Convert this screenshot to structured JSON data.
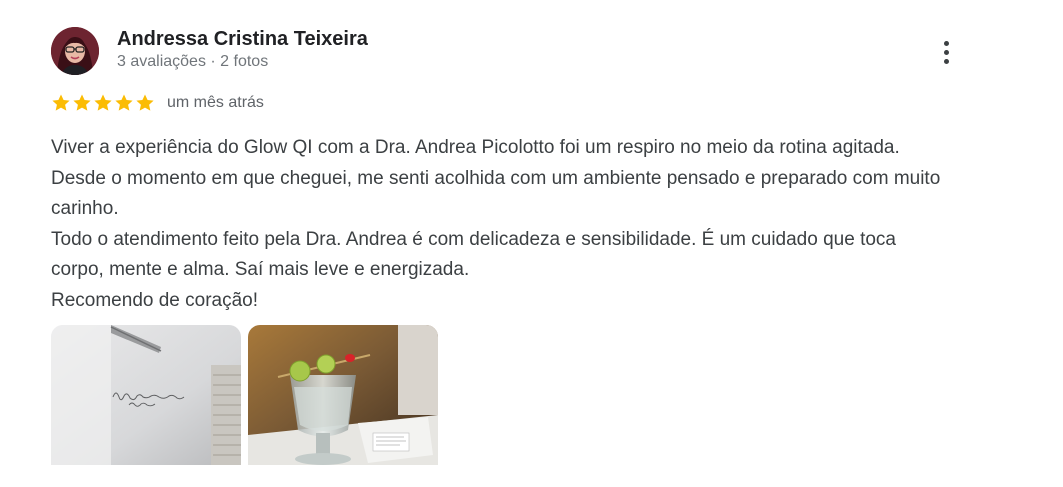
{
  "review": {
    "author": {
      "name": "Andressa Cristina Teixeira",
      "meta": "3 avaliações · 2 fotos",
      "avatar_icon": "user-avatar"
    },
    "rating": {
      "stars": 5,
      "max": 5,
      "star_color": "#fbbc04"
    },
    "date": "um mês atrás",
    "text_lines": [
      "Viver a experiência do Glow QI com a Dra. Andrea Picolotto foi um respiro no meio da rotina agitada. Desde o momento em que cheguei, me senti acolhida com um ambiente pensado e preparado com muito carinho.",
      "Todo o atendimento feito pela Dra. Andrea é com delicadeza e sensibilidade. É um cuidado que toca corpo, mente e alma. Saí mais leve e energizada.",
      "Recomendo de coração!"
    ],
    "photos": [
      {
        "name": "photo-wall-lettering",
        "subject": "white wall with handwritten lettering"
      },
      {
        "name": "photo-glass-with-grapes",
        "subject": "glass of water with grapes on a skewer"
      }
    ],
    "more_icon": "more-vert-icon"
  }
}
